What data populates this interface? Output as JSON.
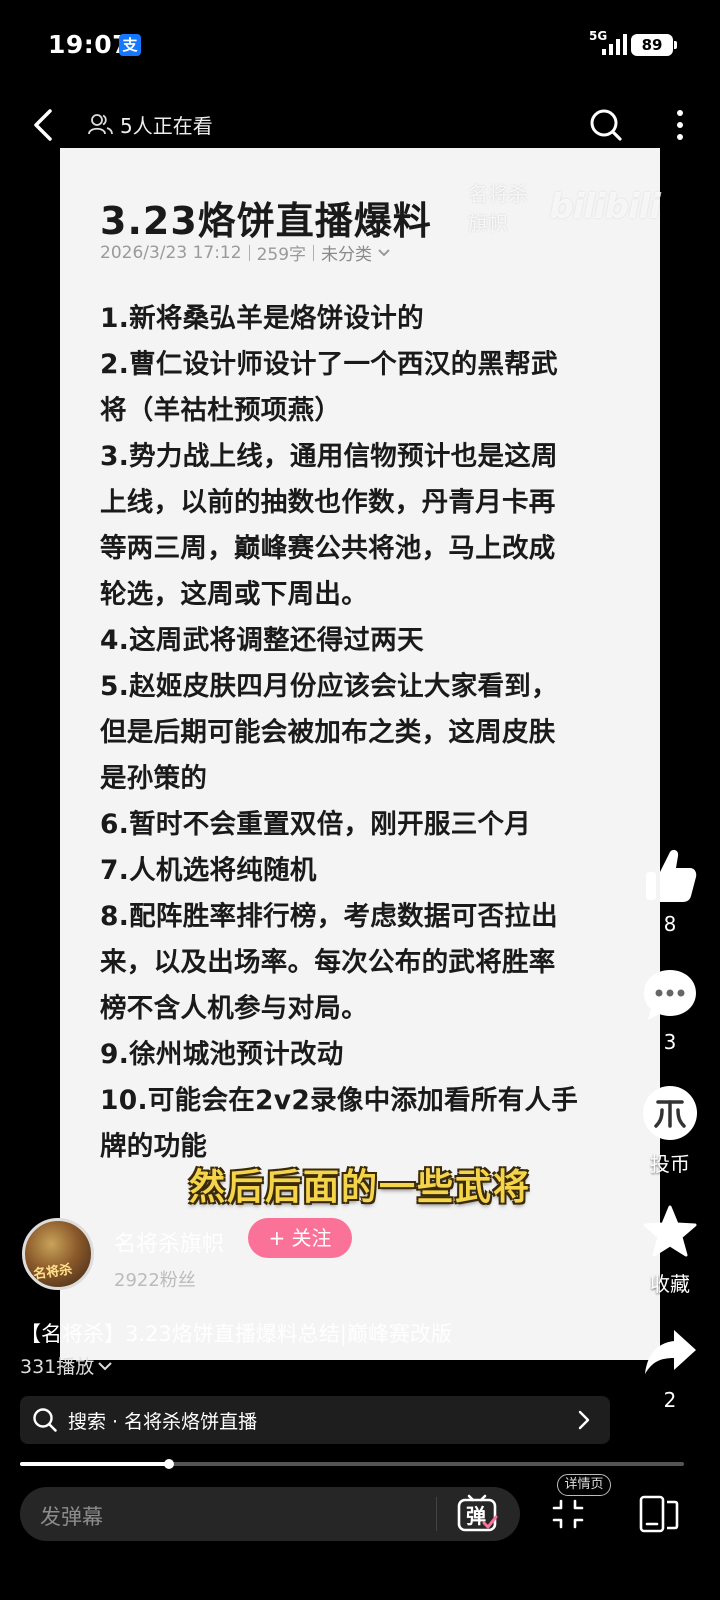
{
  "status_bar": {
    "time": "19:07",
    "alipay_badge": "支",
    "network": "5G",
    "battery": "89"
  },
  "top_bar": {
    "viewers_text": "5人正在看"
  },
  "article": {
    "title": "3.23烙饼直播爆料",
    "watermark_name": "名将杀旗帜",
    "watermark_logo": "bilibili",
    "meta": {
      "datetime": "2026/3/23 17:12",
      "word_count": "259字",
      "category": "未分类"
    },
    "lines": [
      "1.新将桑弘羊是烙饼设计的",
      "2.曹仁设计师设计了一个西汉的黑帮武",
      "将（羊祜杜预项燕）",
      "3.势力战上线，通用信物预计也是这周",
      "上线，以前的抽数也作数，丹青月卡再",
      "等两三周，巅峰赛公共将池，马上改成",
      "轮选，这周或下周出。",
      "4.这周武将调整还得过两天",
      "5.赵姬皮肤四月份应该会让大家看到，",
      "但是后期可能会被加布之类，这周皮肤",
      "是孙策的",
      "6.暂时不会重置双倍，刚开服三个月",
      "7.人机选将纯随机",
      "8.配阵胜率排行榜，考虑数据可否拉出",
      "来，以及出场率。每次公布的武将胜率",
      "榜不含人机参与对局。",
      "9.徐州城池预计改动",
      "10.可能会在2v2录像中添加看所有人手",
      "牌的功能"
    ]
  },
  "subtitle": "然后后面的一些武将",
  "actions": {
    "like_count": "8",
    "comment_count": "3",
    "coin_label": "投币",
    "favorite_label": "收藏",
    "share_count": "2"
  },
  "uploader": {
    "name": "名将杀旗帜",
    "follow_label": "+ 关注",
    "fans": "2922粉丝",
    "avatar_text": "名将杀"
  },
  "video": {
    "title": "【名将杀】3.23烙饼直播爆料总结|巅峰赛改版",
    "plays": "331播放",
    "search_text": "搜索 · 名将杀烙饼直播",
    "progress": 0.225
  },
  "bottom_bar": {
    "danmaku_placeholder": "发弹幕",
    "danmaku_toggle_label": "弹",
    "detail_badge": "详情页"
  },
  "colors": {
    "accent_pink": "#fb7299",
    "subtitle_yellow": "#f4d44a",
    "alipay_blue": "#1677ff"
  }
}
